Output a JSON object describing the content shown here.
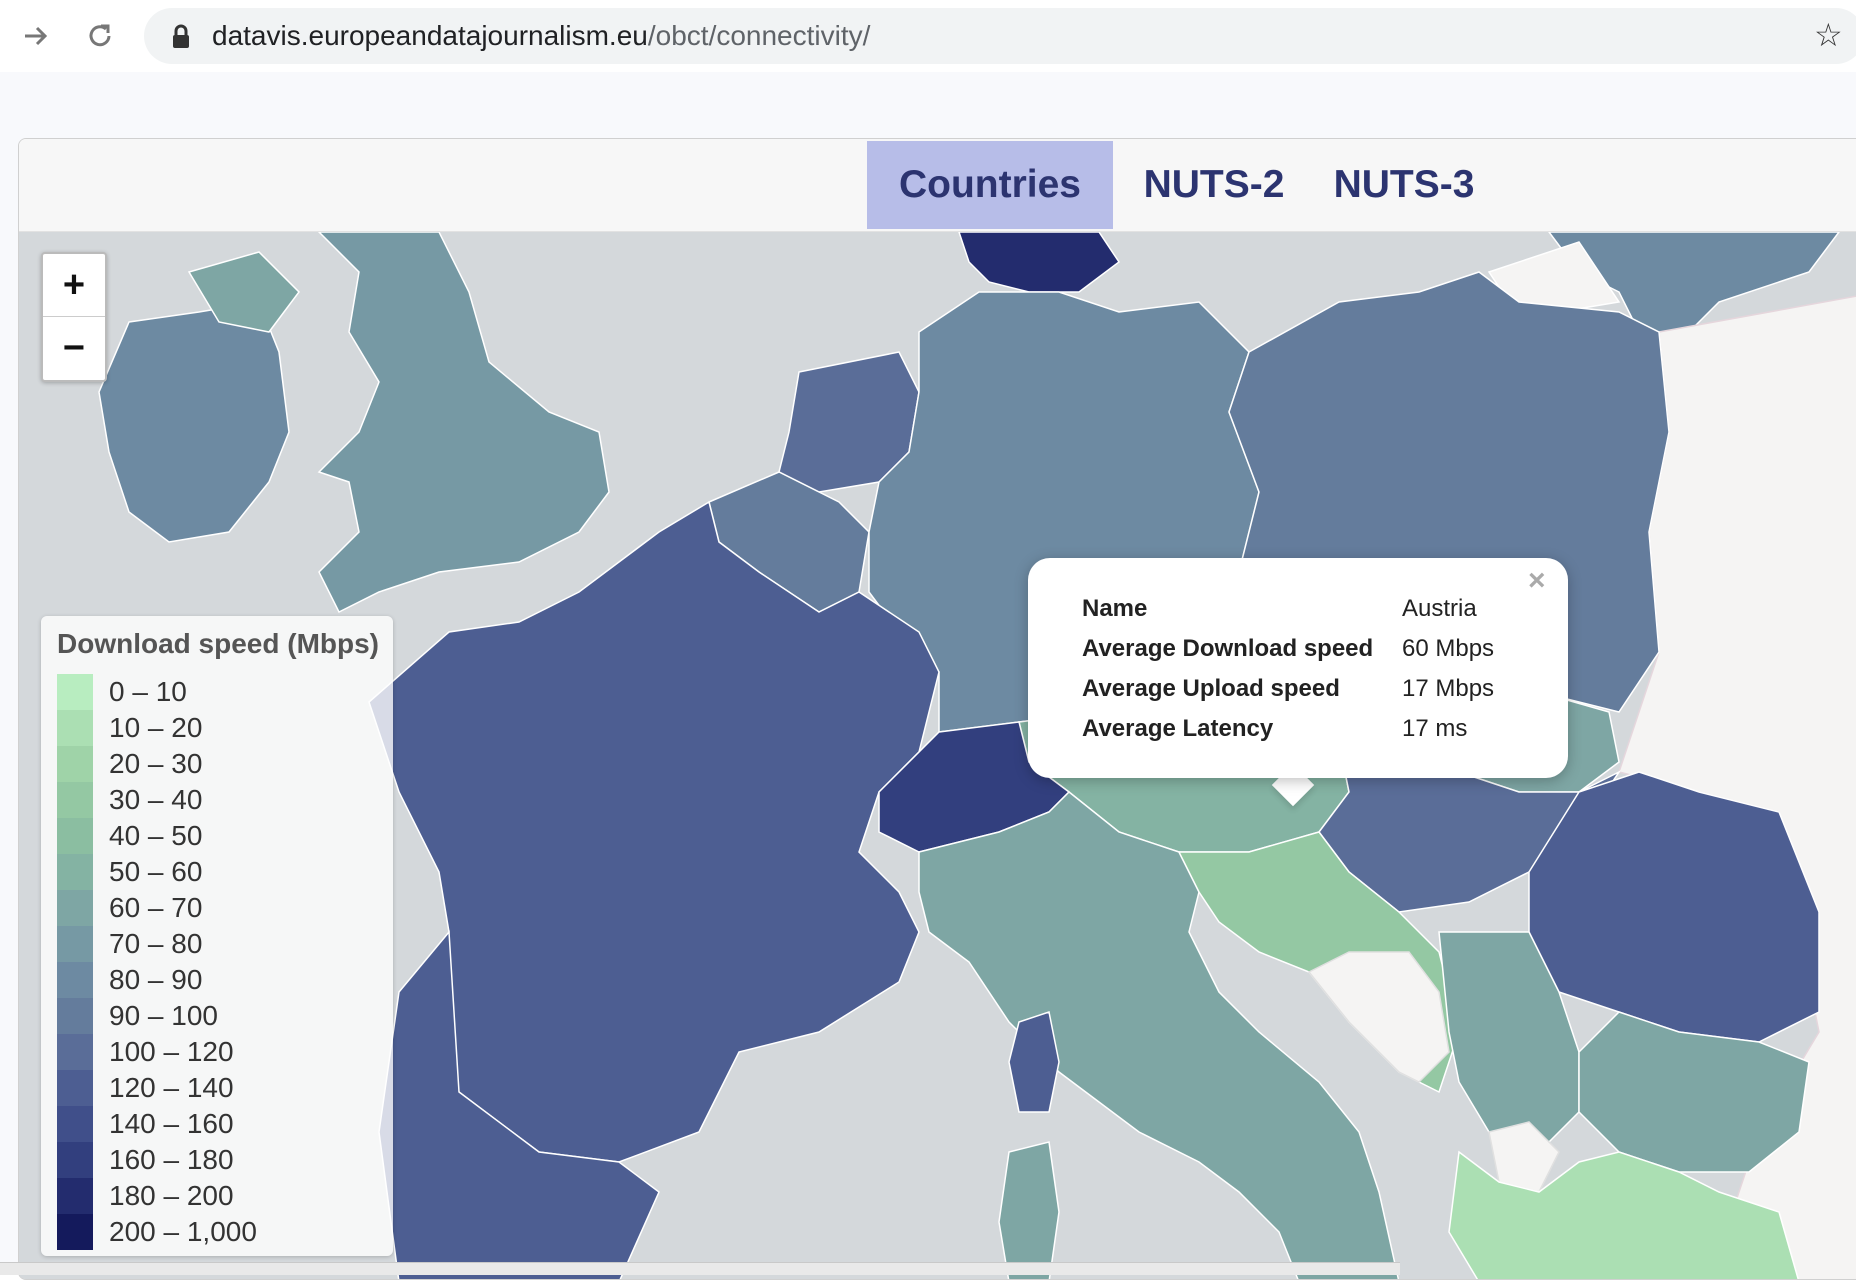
{
  "browser": {
    "url_host": "datavis.europeandatajournalism.eu",
    "url_path": "/obct/connectivity/"
  },
  "tabs": [
    {
      "label": "Countries",
      "active": true
    },
    {
      "label": "NUTS-2",
      "active": false
    },
    {
      "label": "NUTS-3",
      "active": false
    }
  ],
  "zoom": {
    "in_label": "+",
    "out_label": "−"
  },
  "legend": {
    "title": "Download speed (Mbps)",
    "items": [
      {
        "label": "0 – 10",
        "color": "#b8edc0"
      },
      {
        "label": "10 – 20",
        "color": "#abdfb3"
      },
      {
        "label": "20 – 30",
        "color": "#9fd3a8"
      },
      {
        "label": "30 – 40",
        "color": "#94c8a3"
      },
      {
        "label": "40 – 50",
        "color": "#8bbea1"
      },
      {
        "label": "50 – 60",
        "color": "#84b3a3"
      },
      {
        "label": "60 – 70",
        "color": "#7ea6a4"
      },
      {
        "label": "70 – 80",
        "color": "#7699a4"
      },
      {
        "label": "80 – 90",
        "color": "#6d8aa2"
      },
      {
        "label": "90 – 100",
        "color": "#647c9c"
      },
      {
        "label": "100 – 120",
        "color": "#5a6d98"
      },
      {
        "label": "120 – 140",
        "color": "#4d5e92"
      },
      {
        "label": "140 – 160",
        "color": "#404f8a"
      },
      {
        "label": "160 – 180",
        "color": "#323f7e"
      },
      {
        "label": "180 – 200",
        "color": "#232c6e"
      },
      {
        "label": "200 – 1,000",
        "color": "#141a5c"
      }
    ]
  },
  "popup": {
    "rows": [
      {
        "key": "Name",
        "value": "Austria"
      },
      {
        "key": "Average Download speed",
        "value": "60 Mbps"
      },
      {
        "key": "Average Upload speed",
        "value": "17 Mbps"
      },
      {
        "key": "Average Latency",
        "value": "17 ms"
      }
    ]
  },
  "close_symbol": "×",
  "colors": {
    "sea": "#d4d8db",
    "no_data": "#f5f4f3",
    "tab_active": "#b7bde8",
    "tab_text": "#2c3470"
  }
}
